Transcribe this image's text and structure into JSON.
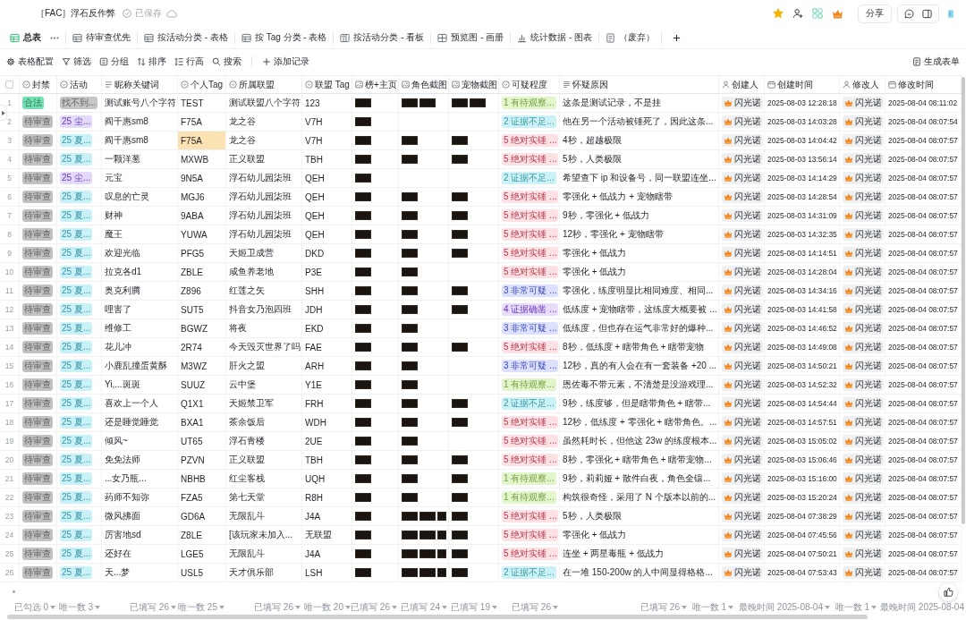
{
  "document": {
    "title": "［FAC］浮石反作弊",
    "status": "已保存"
  },
  "header_actions": {
    "starred": true,
    "share": "分享"
  },
  "tabs": [
    {
      "label": "总表",
      "kind": "table",
      "selected": true
    },
    {
      "label": "待审查优先",
      "kind": "table",
      "selected": false
    },
    {
      "label": "按活动分类 - 表格",
      "kind": "table",
      "selected": false
    },
    {
      "label": "按 Tag 分类 - 表格",
      "kind": "table",
      "selected": false
    },
    {
      "label": "按活动分类 - 看板",
      "kind": "kanban",
      "selected": false
    },
    {
      "label": "预览图 - 画册",
      "kind": "gallery",
      "selected": false
    },
    {
      "label": "统计数据 - 图表",
      "kind": "chart",
      "selected": false
    },
    {
      "label": "（废弃）",
      "kind": "form",
      "selected": false
    }
  ],
  "toolbar": [
    {
      "label": "表格配置",
      "kind": "settings"
    },
    {
      "label": "筛选",
      "kind": "filter"
    },
    {
      "label": "分组",
      "kind": "group"
    },
    {
      "label": "排序",
      "kind": "sort"
    },
    {
      "label": "行高",
      "kind": "row-height"
    },
    {
      "label": "搜索",
      "kind": "search"
    },
    {
      "label": "添加记录",
      "kind": "add"
    }
  ],
  "form_button": "生成表单",
  "table": {
    "select_all": {
      "checked": false
    },
    "columns": [
      {
        "title": "封禁",
        "kind": "select",
        "summary": {
          "text": "已勾选 0",
          "dropdown": true
        }
      },
      {
        "title": "活动",
        "kind": "select",
        "summary": {
          "text": "唯一数 3",
          "dropdown": true
        }
      },
      {
        "title": "昵称关键词",
        "kind": "text",
        "summary": {
          "text": "已填写 26",
          "dropdown": true
        }
      },
      {
        "title": "个人Tag",
        "kind": "select",
        "summary": {
          "text": "唯一数 25",
          "dropdown": true
        }
      },
      {
        "title": "所属联盟",
        "kind": "select",
        "summary": {
          "text": "已填写 26",
          "dropdown": true
        }
      },
      {
        "title": "联盟 Tag",
        "kind": "select",
        "summary": {
          "text": "唯一数 20",
          "dropdown": true
        }
      },
      {
        "title": "榜+主页",
        "kind": "image",
        "summary": {
          "text": "已填写 26",
          "dropdown": true
        }
      },
      {
        "title": "角色截图",
        "kind": "image",
        "summary": {
          "text": "已填写 24",
          "dropdown": true
        }
      },
      {
        "title": "宠物截图",
        "kind": "image",
        "summary": {
          "text": "已填写 19",
          "dropdown": true
        }
      },
      {
        "title": "可疑程度",
        "kind": "select",
        "summary": {
          "text": "已填写 26",
          "dropdown": true
        }
      },
      {
        "title": "怀疑原因",
        "kind": "longtext",
        "summary": {
          "text": "已填写 26",
          "dropdown": true
        }
      },
      {
        "title": "创建人",
        "kind": "person",
        "summary": {
          "text": "唯一数 1",
          "dropdown": true
        }
      },
      {
        "title": "创建时间",
        "kind": "date",
        "summary": {
          "text": "最晚时间 2025-08-04",
          "dropdown": true
        }
      },
      {
        "title": "修改人",
        "kind": "person",
        "summary": {
          "text": "唯一数 1",
          "dropdown": true
        }
      },
      {
        "title": "修改时间",
        "kind": "date",
        "summary": {
          "text": "最晚时间 2025-08-04",
          "dropdown": false
        }
      }
    ],
    "rows": [
      {
        "number": "1",
        "ban": {
          "text": "合法",
          "color": "#73e0b4"
        },
        "activity": {
          "text": "找不到...",
          "color": "#c6c6c6"
        },
        "nickname": "测试账号八个字符",
        "tag": {
          "text": "TEST",
          "selected": false
        },
        "alliance": "测试联盟八个字符",
        "alliance_tag": "123",
        "rank_page": [
          {
            "kind": "photo"
          }
        ],
        "role_shots": [
          {
            "kind": "photo"
          },
          {
            "kind": "photo"
          }
        ],
        "pet_shots": [
          {
            "kind": "photo"
          },
          {
            "kind": "photo"
          }
        ],
        "suspicion": {
          "text": "1 有待观察...",
          "color": "#e3f5cb"
        },
        "reason": "这条是测试记录，不是挂",
        "creator": "闪光诺",
        "created": "2025-08-03 12:28:18",
        "modifier": "闪光诺",
        "modified": "2025-08-04 08:11:02"
      },
      {
        "number": "2",
        "ban": {
          "text": "待审查",
          "color": "#c2c2c2"
        },
        "activity": {
          "text": "25 尘...",
          "color": "#e4d9fb"
        },
        "nickname": "阎千惠sm8",
        "tag": {
          "text": "F75A",
          "selected": false
        },
        "alliance": "龙之谷",
        "alliance_tag": "V7H",
        "rank_page": [
          {
            "kind": "photo"
          }
        ],
        "suspicion": {
          "text": "2 证据不足...",
          "color": "#caf2f7"
        },
        "reason": "他在另一个活动被锤死了，因此这条...",
        "creator": "闪光诺",
        "created": "2025-08-03 14:03:28",
        "modifier": "闪光诺",
        "modified": "2025-08-04 08:07:54"
      },
      {
        "number": "3",
        "ban": {
          "text": "待审查",
          "color": "#c2c2c2"
        },
        "activity": {
          "text": "25 夏...",
          "color": "#c9f1f8"
        },
        "nickname": "阎千惠sm8",
        "tag": {
          "text": "F75A",
          "selected": true
        },
        "alliance": "龙之谷",
        "alliance_tag": "V7H",
        "rank_page": [
          {
            "kind": "photo"
          }
        ],
        "role_shots": [
          {
            "kind": "photo"
          }
        ],
        "pet_shots": [
          {
            "kind": "photo"
          }
        ],
        "suspicion": {
          "text": "5 绝对实锤 ...",
          "color": "#fde1e5"
        },
        "reason": "4秒，超越极限",
        "creator": "闪光诺",
        "created": "2025-08-03 14:04:42",
        "modifier": "闪光诺",
        "modified": "2025-08-04 08:07:57"
      },
      {
        "number": "4",
        "ban": {
          "text": "待审查",
          "color": "#c2c2c2"
        },
        "activity": {
          "text": "25 夏...",
          "color": "#c9f1f8"
        },
        "nickname": "一颗洋葱",
        "tag": {
          "text": "MXWB",
          "selected": false
        },
        "alliance": "正义联盟",
        "alliance_tag": "TBH",
        "rank_page": [
          {
            "kind": "photo"
          }
        ],
        "role_shots": [
          {
            "kind": "photo"
          }
        ],
        "pet_shots": [
          {
            "kind": "photo"
          }
        ],
        "suspicion": {
          "text": "5 绝对实锤 ...",
          "color": "#fde1e5"
        },
        "reason": "5秒，人类极限",
        "creator": "闪光诺",
        "created": "2025-08-03 13:56:14",
        "modifier": "闪光诺",
        "modified": "2025-08-04 08:07:57"
      },
      {
        "number": "5",
        "ban": {
          "text": "待审查",
          "color": "#c2c2c2"
        },
        "activity": {
          "text": "25 尘...",
          "color": "#e4d9fb"
        },
        "nickname": "元宝",
        "tag": {
          "text": "9N5A",
          "selected": false
        },
        "alliance": "浮石幼儿园柒班",
        "alliance_tag": "QEH",
        "rank_page": [
          {
            "kind": "photo"
          }
        ],
        "suspicion": {
          "text": "2 证据不足...",
          "color": "#caf2f7"
        },
        "reason": "希望查下 ip 和设备号，同一联盟连坐...",
        "creator": "闪光诺",
        "created": "2025-08-03 14:14:29",
        "modifier": "闪光诺",
        "modified": "2025-08-04 08:07:57"
      },
      {
        "number": "6",
        "ban": {
          "text": "待审查",
          "color": "#c2c2c2"
        },
        "activity": {
          "text": "25 夏...",
          "color": "#c9f1f8"
        },
        "nickname": "叹息的亡灵",
        "tag": {
          "text": "MGJ6",
          "selected": false
        },
        "alliance": "浮石幼儿园柒班",
        "alliance_tag": "QEH",
        "rank_page": [
          {
            "kind": "photo"
          }
        ],
        "role_shots": [
          {
            "kind": "photo"
          }
        ],
        "pet_shots": [
          {
            "kind": "photo"
          }
        ],
        "suspicion": {
          "text": "5 绝对实锤 ...",
          "color": "#fde1e5"
        },
        "reason": "零强化 + 低战力 + 宠物瞎带",
        "creator": "闪光诺",
        "created": "2025-08-03 14:28:54",
        "modifier": "闪光诺",
        "modified": "2025-08-04 08:07:57"
      },
      {
        "number": "7",
        "ban": {
          "text": "待审查",
          "color": "#c2c2c2"
        },
        "activity": {
          "text": "25 夏...",
          "color": "#c9f1f8"
        },
        "nickname": "财神",
        "tag": {
          "text": "9ABA",
          "selected": false
        },
        "alliance": "浮石幼儿园柒班",
        "alliance_tag": "QEH",
        "rank_page": [
          {
            "kind": "photo"
          }
        ],
        "role_shots": [
          {
            "kind": "photo"
          }
        ],
        "pet_shots": [
          {
            "kind": "photo"
          }
        ],
        "suspicion": {
          "text": "5 绝对实锤 ...",
          "color": "#fde1e5"
        },
        "reason": "9秒，零强化 + 低战力",
        "creator": "闪光诺",
        "created": "2025-08-03 14:31:09",
        "modifier": "闪光诺",
        "modified": "2025-08-04 08:07:57"
      },
      {
        "number": "8",
        "ban": {
          "text": "待审查",
          "color": "#c2c2c2"
        },
        "activity": {
          "text": "25 夏...",
          "color": "#c9f1f8"
        },
        "nickname": "魔王",
        "tag": {
          "text": "YUWA",
          "selected": false
        },
        "alliance": "浮石幼儿园柒班",
        "alliance_tag": "QEH",
        "rank_page": [
          {
            "kind": "photo"
          }
        ],
        "role_shots": [
          {
            "kind": "photo"
          }
        ],
        "pet_shots": [
          {
            "kind": "photo"
          }
        ],
        "suspicion": {
          "text": "5 绝对实锤 ...",
          "color": "#fde1e5"
        },
        "reason": "12秒，零强化 + 宠物瞎带",
        "creator": "闪光诺",
        "created": "2025-08-03 14:32:35",
        "modifier": "闪光诺",
        "modified": "2025-08-04 08:07:57"
      },
      {
        "number": "9",
        "ban": {
          "text": "待审查",
          "color": "#c2c2c2"
        },
        "activity": {
          "text": "25 夏...",
          "color": "#c9f1f8"
        },
        "nickname": "欢迎光临",
        "tag": {
          "text": "PFG5",
          "selected": false
        },
        "alliance": "天姬卫成营",
        "alliance_tag": "DKD",
        "rank_page": [
          {
            "kind": "photo"
          }
        ],
        "role_shots": [
          {
            "kind": "photo"
          }
        ],
        "pet_shots": [
          {
            "kind": "photo"
          }
        ],
        "suspicion": {
          "text": "5 绝对实锤 ...",
          "color": "#fde1e5"
        },
        "reason": "零强化 + 低战力",
        "creator": "闪光诺",
        "created": "2025-08-03 14:14:51",
        "modifier": "闪光诺",
        "modified": "2025-08-04 08:07:57"
      },
      {
        "number": "10",
        "ban": {
          "text": "待审查",
          "color": "#c2c2c2"
        },
        "activity": {
          "text": "25 夏...",
          "color": "#c9f1f8"
        },
        "nickname": "拉克各d1",
        "tag": {
          "text": "ZBLE",
          "selected": false
        },
        "alliance": "咸鱼养老地",
        "alliance_tag": "P3E",
        "rank_page": [
          {
            "kind": "photo"
          }
        ],
        "role_shots": [
          {
            "kind": "photo"
          }
        ],
        "suspicion": {
          "text": "5 绝对实锤 ...",
          "color": "#fde1e5"
        },
        "reason": "零强化 + 低战力",
        "creator": "闪光诺",
        "created": "2025-08-03 14:28:04",
        "modifier": "闪光诺",
        "modified": "2025-08-04 08:07:57"
      },
      {
        "number": "11",
        "ban": {
          "text": "待审查",
          "color": "#c2c2c2"
        },
        "activity": {
          "text": "25 夏...",
          "color": "#c9f1f8"
        },
        "nickname": "奥克利腾",
        "tag": {
          "text": "Z896",
          "selected": false
        },
        "alliance": "红莲之矢",
        "alliance_tag": "SHH",
        "rank_page": [
          {
            "kind": "photo"
          }
        ],
        "role_shots": [
          {
            "kind": "photo"
          }
        ],
        "pet_shots": [
          {
            "kind": "photo"
          }
        ],
        "suspicion": {
          "text": "3 非常可疑 ...",
          "color": "#dde1fd"
        },
        "reason": "零强化，练度明显比相同难度、相同...",
        "creator": "闪光诺",
        "created": "2025-08-03 14:34:16",
        "modifier": "闪光诺",
        "modified": "2025-08-04 08:07:57"
      },
      {
        "number": "12",
        "ban": {
          "text": "待审查",
          "color": "#c2c2c2"
        },
        "activity": {
          "text": "25 夏...",
          "color": "#c9f1f8"
        },
        "nickname": "哩害了",
        "tag": {
          "text": "SUT5",
          "selected": false
        },
        "alliance": "抖音女乃泡四班",
        "alliance_tag": "JDH",
        "rank_page": [
          {
            "kind": "photo"
          }
        ],
        "role_shots": [
          {
            "kind": "photo"
          }
        ],
        "pet_shots": [
          {
            "kind": "photo"
          }
        ],
        "suspicion": {
          "text": "4 证据确凿 ...",
          "color": "#e8dcfc"
        },
        "reason": "低练度 + 宠物瞎带，这练度大概要被 ...",
        "creator": "闪光诺",
        "created": "2025-08-03 14:41:58",
        "modifier": "闪光诺",
        "modified": "2025-08-04 08:07:57"
      },
      {
        "number": "13",
        "ban": {
          "text": "待审查",
          "color": "#c2c2c2"
        },
        "activity": {
          "text": "25 夏...",
          "color": "#c9f1f8"
        },
        "nickname": "维修工",
        "tag": {
          "text": "BGWZ",
          "selected": false
        },
        "alliance": "将夜",
        "alliance_tag": "EKD",
        "rank_page": [
          {
            "kind": "photo"
          }
        ],
        "role_shots": [
          {
            "kind": "photo"
          }
        ],
        "suspicion": {
          "text": "3 非常可疑 ...",
          "color": "#dde1fd"
        },
        "reason": "低练度，但也存在运气非常好的爆种...",
        "creator": "闪光诺",
        "created": "2025-08-03 14:46:52",
        "modifier": "闪光诺",
        "modified": "2025-08-04 08:07:57"
      },
      {
        "number": "14",
        "ban": {
          "text": "待审查",
          "color": "#c2c2c2"
        },
        "activity": {
          "text": "25 夏...",
          "color": "#c9f1f8"
        },
        "nickname": "花儿冲",
        "tag": {
          "text": "2R74",
          "selected": false
        },
        "alliance": "今天毁灭世界了吗",
        "alliance_tag": "FAE",
        "rank_page": [
          {
            "kind": "photo"
          }
        ],
        "role_shots": [
          {
            "kind": "photo"
          }
        ],
        "pet_shots": [
          {
            "kind": "photo"
          }
        ],
        "suspicion": {
          "text": "5 绝对实锤 ...",
          "color": "#fde1e5"
        },
        "reason": "8秒，低练度 + 瞎带角色 + 瞎带宠物",
        "creator": "闪光诺",
        "created": "2025-08-03 14:49:08",
        "modifier": "闪光诺",
        "modified": "2025-08-04 08:07:57"
      },
      {
        "number": "15",
        "ban": {
          "text": "待审查",
          "color": "#c2c2c2"
        },
        "activity": {
          "text": "25 夏...",
          "color": "#c9f1f8"
        },
        "nickname": "小鹿乱撞蛋黄酥",
        "tag": {
          "text": "M3WZ",
          "selected": false
        },
        "alliance": "肝火之盟",
        "alliance_tag": "ARH",
        "rank_page": [
          {
            "kind": "photo"
          }
        ],
        "role_shots": [
          {
            "kind": "photo"
          }
        ],
        "suspicion": {
          "text": "3 非常可疑 ...",
          "color": "#dde1fd"
        },
        "reason": "12秒，真的有人会在有一套装备 +20 ...",
        "creator": "闪光诺",
        "created": "2025-08-03 14:50:21",
        "modifier": "闪光诺",
        "modified": "2025-08-04 08:07:57"
      },
      {
        "number": "16",
        "ban": {
          "text": "待审查",
          "color": "#c2c2c2"
        },
        "activity": {
          "text": "25 夏...",
          "color": "#c9f1f8"
        },
        "nickname": "Yi,...斑斑",
        "tag": {
          "text": "SUUZ",
          "selected": false
        },
        "alliance": "云中堡",
        "alliance_tag": "Y1E",
        "rank_page": [
          {
            "kind": "photo"
          }
        ],
        "role_shots": [
          {
            "kind": "photo"
          }
        ],
        "suspicion": {
          "text": "1 有待观察...",
          "color": "#e3f5cb"
        },
        "reason": "恩佐毒不带元素，不清楚是没游戏理...",
        "creator": "闪光诺",
        "created": "2025-08-03 14:52:32",
        "modifier": "闪光诺",
        "modified": "2025-08-04 08:07:57"
      },
      {
        "number": "17",
        "ban": {
          "text": "待审查",
          "color": "#c2c2c2"
        },
        "activity": {
          "text": "25 夏...",
          "color": "#c9f1f8"
        },
        "nickname": "喜欢上一个人",
        "tag": {
          "text": "Q1X1",
          "selected": false
        },
        "alliance": "天姬禁卫军",
        "alliance_tag": "FRH",
        "rank_page": [
          {
            "kind": "photo"
          }
        ],
        "role_shots": [
          {
            "kind": "photo"
          }
        ],
        "pet_shots": [
          {
            "kind": "photo"
          }
        ],
        "suspicion": {
          "text": "2 证据不足...",
          "color": "#caf2f7"
        },
        "reason": "9秒，练度够，但是瞎带角色 + 瞎带...",
        "creator": "闪光诺",
        "created": "2025-08-03 14:54:44",
        "modifier": "闪光诺",
        "modified": "2025-08-04 08:07:57"
      },
      {
        "number": "18",
        "ban": {
          "text": "待审查",
          "color": "#c2c2c2"
        },
        "activity": {
          "text": "25 夏...",
          "color": "#c9f1f8"
        },
        "nickname": "还是睡觉睡觉",
        "tag": {
          "text": "BXA1",
          "selected": false
        },
        "alliance": "茶余饭后",
        "alliance_tag": "WDH",
        "rank_page": [
          {
            "kind": "photo"
          }
        ],
        "role_shots": [
          {
            "kind": "photo"
          }
        ],
        "pet_shots": [
          {
            "kind": "photo"
          }
        ],
        "suspicion": {
          "text": "5 绝对实锤 ...",
          "color": "#fde1e5"
        },
        "reason": "12秒，低练度 + 零强化 + 瞎带角色。...",
        "creator": "闪光诺",
        "created": "2025-08-03 14:57:51",
        "modifier": "闪光诺",
        "modified": "2025-08-04 08:07:57"
      },
      {
        "number": "19",
        "ban": {
          "text": "待审查",
          "color": "#c2c2c2"
        },
        "activity": {
          "text": "25 夏...",
          "color": "#c9f1f8"
        },
        "nickname": "倾风~",
        "tag": {
          "text": "UT65",
          "selected": false
        },
        "alliance": "浮石青楼",
        "alliance_tag": "2UE",
        "rank_page": [
          {
            "kind": "photo"
          }
        ],
        "role_shots": [
          {
            "kind": "photo"
          }
        ],
        "suspicion": {
          "text": "5 绝对实锤 ...",
          "color": "#fde1e5"
        },
        "reason": "虽然耗时长，但他这 23w 的练度根本...",
        "creator": "闪光诺",
        "created": "2025-08-03 15:05:02",
        "modifier": "闪光诺",
        "modified": "2025-08-04 08:07:57"
      },
      {
        "number": "20",
        "ban": {
          "text": "待审查",
          "color": "#c2c2c2"
        },
        "activity": {
          "text": "25 夏...",
          "color": "#c9f1f8"
        },
        "nickname": "免免法师",
        "tag": {
          "text": "PZVN",
          "selected": false
        },
        "alliance": "正义联盟",
        "alliance_tag": "TBH",
        "rank_page": [
          {
            "kind": "photo"
          }
        ],
        "role_shots": [
          {
            "kind": "photo"
          }
        ],
        "pet_shots": [
          {
            "kind": "photo"
          }
        ],
        "suspicion": {
          "text": "5 绝对实锤 ...",
          "color": "#fde1e5"
        },
        "reason": "8秒，零强化 + 瞎带角色 + 瞎带宠物...",
        "creator": "闪光诺",
        "created": "2025-08-03 15:06:46",
        "modifier": "闪光诺",
        "modified": "2025-08-04 08:07:57"
      },
      {
        "number": "21",
        "ban": {
          "text": "待审查",
          "color": "#c2c2c2"
        },
        "activity": {
          "text": "25 夏...",
          "color": "#c9f1f8"
        },
        "nickname": "...女乃瓶...",
        "tag": {
          "text": "NBHB",
          "selected": false
        },
        "alliance": "红尘客栈",
        "alliance_tag": "UQH",
        "rank_page": [
          {
            "kind": "photo"
          }
        ],
        "role_shots": [
          {
            "kind": "photo"
          }
        ],
        "pet_shots": [
          {
            "kind": "photo"
          }
        ],
        "suspicion": {
          "text": "1 有待观察...",
          "color": "#e3f5cb"
        },
        "reason": "9秒，莉莉娅 + 散件白夜，角色全镶...",
        "creator": "闪光诺",
        "created": "2025-08-03 15:16:00",
        "modifier": "闪光诺",
        "modified": "2025-08-04 08:07:57"
      },
      {
        "number": "22",
        "ban": {
          "text": "待审查",
          "color": "#c2c2c2"
        },
        "activity": {
          "text": "25 夏...",
          "color": "#c9f1f8"
        },
        "nickname": "药师不知弥",
        "tag": {
          "text": "FZA5",
          "selected": false
        },
        "alliance": "第七天堂",
        "alliance_tag": "R8H",
        "rank_page": [
          {
            "kind": "photo"
          }
        ],
        "role_shots": [
          {
            "kind": "photo"
          }
        ],
        "pet_shots": [
          {
            "kind": "photo"
          }
        ],
        "suspicion": {
          "text": "1 有待观察...",
          "color": "#e3f5cb"
        },
        "reason": "构筑很奇怪，采用了 N 个版本以前的...",
        "creator": "闪光诺",
        "created": "2025-08-03 15:20:24",
        "modifier": "闪光诺",
        "modified": "2025-08-04 08:07:57"
      },
      {
        "number": "23",
        "ban": {
          "text": "待审查",
          "color": "#c2c2c2"
        },
        "activity": {
          "text": "25 夏...",
          "color": "#c9f1f8"
        },
        "nickname": "微风拂面",
        "tag": {
          "text": "GD6A",
          "selected": false
        },
        "alliance": "无限乱斗",
        "alliance_tag": "J4A",
        "rank_page": [
          {
            "kind": "photo"
          }
        ],
        "role_shots": [
          {
            "kind": "photo"
          },
          {
            "kind": "photo"
          },
          {
            "kind": "portrait"
          }
        ],
        "pet_shots": [
          {
            "kind": "photo"
          }
        ],
        "suspicion": {
          "text": "5 绝对实锤 ...",
          "color": "#fde1e5"
        },
        "reason": "5秒，人类极限",
        "creator": "闪光诺",
        "created": "2025-08-04 07:38:29",
        "modifier": "闪光诺",
        "modified": "2025-08-04 08:07:57"
      },
      {
        "number": "24",
        "ban": {
          "text": "待审查",
          "color": "#c2c2c2"
        },
        "activity": {
          "text": "25 夏...",
          "color": "#c9f1f8"
        },
        "nickname": "厉害地sd",
        "tag": {
          "text": "Z8LE",
          "selected": false
        },
        "alliance": "[该玩家未加入...",
        "alliance_tag": "无联盟",
        "rank_page": [
          {
            "kind": "photo"
          }
        ],
        "role_shots": [
          {
            "kind": "photo"
          },
          {
            "kind": "photo"
          },
          {
            "kind": "portrait"
          }
        ],
        "pet_shots": [
          {
            "kind": "photo"
          }
        ],
        "suspicion": {
          "text": "5 绝对实锤 ...",
          "color": "#fde1e5"
        },
        "reason": "零强化 + 低战力",
        "creator": "闪光诺",
        "created": "2025-08-04 07:45:56",
        "modifier": "闪光诺",
        "modified": "2025-08-04 08:07:57"
      },
      {
        "number": "25",
        "ban": {
          "text": "待审查",
          "color": "#c2c2c2"
        },
        "activity": {
          "text": "25 夏...",
          "color": "#c9f1f8"
        },
        "nickname": "还好在",
        "tag": {
          "text": "LGE5",
          "selected": false
        },
        "alliance": "无限乱斗",
        "alliance_tag": "J4A",
        "rank_page": [
          {
            "kind": "photo"
          }
        ],
        "role_shots": [
          {
            "kind": "photo"
          },
          {
            "kind": "photo"
          },
          {
            "kind": "portrait"
          }
        ],
        "pet_shots": [
          {
            "kind": "photo"
          }
        ],
        "suspicion": {
          "text": "5 绝对实锤 ...",
          "color": "#fde1e5"
        },
        "reason": "连坐 + 两星毒瓶 + 低战力",
        "creator": "闪光诺",
        "created": "2025-08-04 07:50:21",
        "modifier": "闪光诺",
        "modified": "2025-08-04 08:07:57"
      },
      {
        "number": "26",
        "ban": {
          "text": "待审查",
          "color": "#c2c2c2"
        },
        "activity": {
          "text": "25 夏...",
          "color": "#c9f1f8"
        },
        "nickname": "天...梦",
        "tag": {
          "text": "USL5",
          "selected": false
        },
        "alliance": "天才俱乐部",
        "alliance_tag": "LSH",
        "rank_page": [
          {
            "kind": "photo"
          }
        ],
        "role_shots": [
          {
            "kind": "photo"
          },
          {
            "kind": "photo"
          },
          {
            "kind": "portrait"
          }
        ],
        "pet_shots": [
          {
            "kind": "photo"
          }
        ],
        "suspicion": {
          "text": "2 证据不足...",
          "color": "#caf2f7"
        },
        "reason": "在一堆 150-200w 的人中间显得格格...",
        "creator": "闪光诺",
        "created": "2025-08-04 07:53:43",
        "modifier": "闪光诺",
        "modified": "2025-08-04 08:07:57"
      }
    ]
  }
}
